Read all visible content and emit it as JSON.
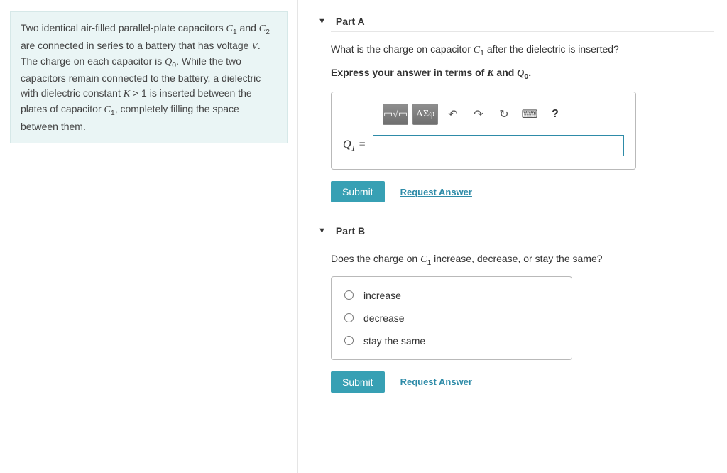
{
  "problem": {
    "text_html": "Two identical air-filled parallel-plate capacitors <span class='math'>C</span><span class='sub'>1</span> and <span class='math'>C</span><span class='sub'>2</span> are connected in series to a battery that has voltage <span class='math'>V</span>. The charge on each capacitor is <span class='math'>Q</span><span class='sub'>0</span>. While the two capacitors remain connected to the battery, a dielectric with dielectric constant <span class='math'>K</span> &gt; 1 is inserted between the plates of capacitor <span class='math'>C</span><span class='sub'>1</span>, completely filling the space between them."
  },
  "partA": {
    "title": "Part A",
    "question_html": "What is the charge on capacitor <span class='math-serif'>C</span><span class='sub'>1</span> after the dielectric is inserted?",
    "instruction_html": "Express your answer in terms of <span class='math-serif'>K</span> and <span class='math-serif'>Q</span><span class='sub'>0</span>.",
    "toolbar": {
      "template_label": "▭√▭",
      "greek_label": "ΑΣφ",
      "undo": "↶",
      "redo": "↷",
      "reset": "↻",
      "keyboard": "⌨",
      "help": "?"
    },
    "input_label_html": "<span class='math-serif'>Q</span><span class='sub'>1</span> =",
    "input_value": "",
    "submit": "Submit",
    "request": "Request Answer"
  },
  "partB": {
    "title": "Part B",
    "question_html": "Does the charge on <span class='math-serif'>C</span><span class='sub'>1</span> increase, decrease, or stay the same?",
    "options": [
      "increase",
      "decrease",
      "stay the same"
    ],
    "submit": "Submit",
    "request": "Request Answer"
  }
}
